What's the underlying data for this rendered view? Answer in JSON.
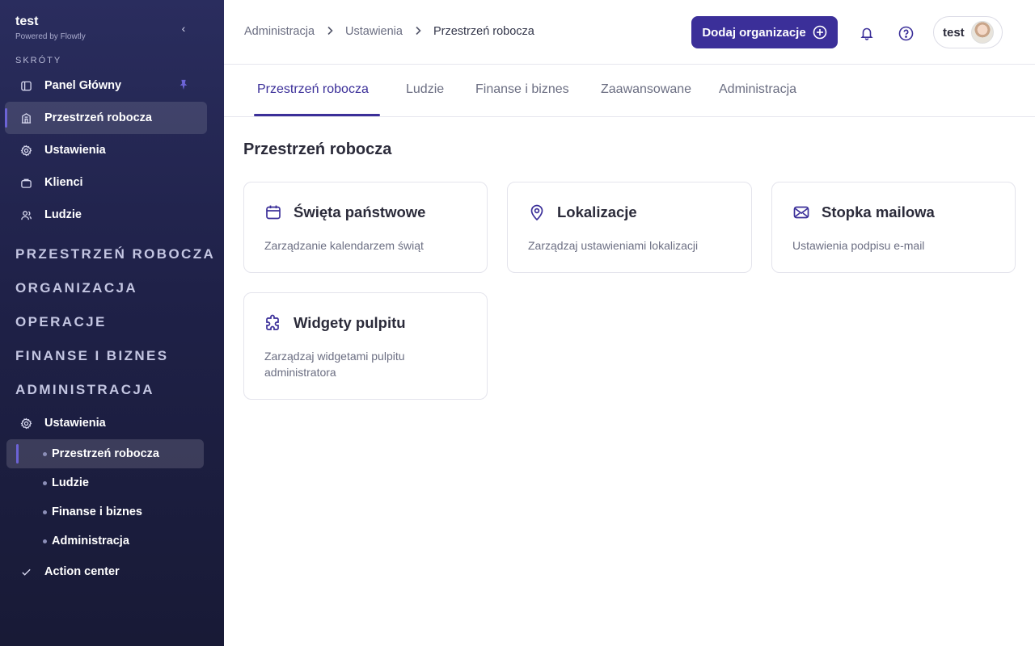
{
  "brand": {
    "name": "test",
    "powered_by": "Powered by Flowtly"
  },
  "sidebar": {
    "shortcuts_label": "SKRÓTY",
    "shortcuts": [
      {
        "label": "Panel Główny",
        "icon": "sidebar-panel-icon",
        "pinned": true
      },
      {
        "label": "Przestrzeń robocza",
        "icon": "building-icon",
        "active": true
      },
      {
        "label": "Ustawienia",
        "icon": "gear-icon"
      },
      {
        "label": "Klienci",
        "icon": "briefcase-icon"
      },
      {
        "label": "Ludzie",
        "icon": "users-icon"
      }
    ],
    "groups": [
      "PRZESTRZEŃ ROBOCZA",
      "ORGANIZACJA",
      "OPERACJE",
      "FINANSE I BIZNES",
      "ADMINISTRACJA"
    ],
    "settings_label": "Ustawienia",
    "settings_sub": [
      {
        "label": "Przestrzeń robocza",
        "active": true
      },
      {
        "label": "Ludzie"
      },
      {
        "label": "Finanse i biznes"
      },
      {
        "label": "Administracja"
      }
    ],
    "action_center_label": "Action center"
  },
  "header": {
    "breadcrumb": [
      "Administracja",
      "Ustawienia",
      "Przestrzeń robocza"
    ],
    "add_org_label": "Dodaj organizacje",
    "user_name": "test"
  },
  "tabs": [
    "Przestrzeń robocza",
    "Ludzie",
    "Finanse i biznes",
    "Zaawansowane",
    "Administracja"
  ],
  "main": {
    "title": "Przestrzeń robocza",
    "cards": [
      {
        "title": "Święta państwowe",
        "desc": "Zarządzanie kalendarzem świąt",
        "icon": "calendar-icon"
      },
      {
        "title": "Lokalizacje",
        "desc": "Zarządzaj ustawieniami lokalizacji",
        "icon": "map-pin-icon"
      },
      {
        "title": "Stopka mailowa",
        "desc": "Ustawienia podpisu e-mail",
        "icon": "mail-icon"
      },
      {
        "title": "Widgety pulpitu",
        "desc": "Zarządzaj widgetami pulpitu administratora",
        "icon": "puzzle-icon"
      }
    ]
  },
  "colors": {
    "accent": "#3b2f99",
    "sidebar_bg": "#1f2148",
    "highlight": "#6c63d6"
  }
}
